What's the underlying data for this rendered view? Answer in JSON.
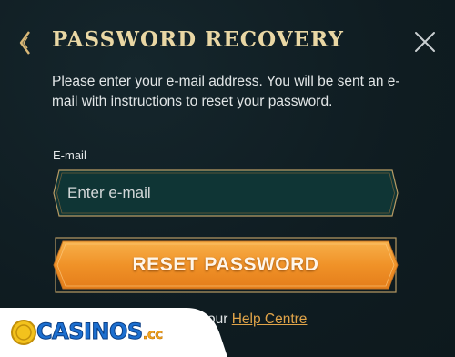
{
  "dialog": {
    "title": "PASSWORD RECOVERY",
    "back_icon": "chevron-left-icon",
    "close_icon": "close-icon"
  },
  "intro": {
    "text": "Please enter your e-mail address. You will be sent an e-mail with instructions to reset your password."
  },
  "email": {
    "label": "E-mail",
    "placeholder": "Enter e-mail",
    "value": ""
  },
  "reset_button": {
    "label": "RESET PASSWORD"
  },
  "help": {
    "prefix": "our ",
    "link_label": "Help Centre"
  },
  "watermark": {
    "text": "CASINOS",
    "suffix": ".cc"
  },
  "colors": {
    "background": "#0f1d22",
    "title_gold": "#e9d7a4",
    "frame_gold": "#b79a63",
    "button_orange": "#f0962a",
    "link_orange": "#e0a449",
    "input_bg": "#0f3535"
  }
}
